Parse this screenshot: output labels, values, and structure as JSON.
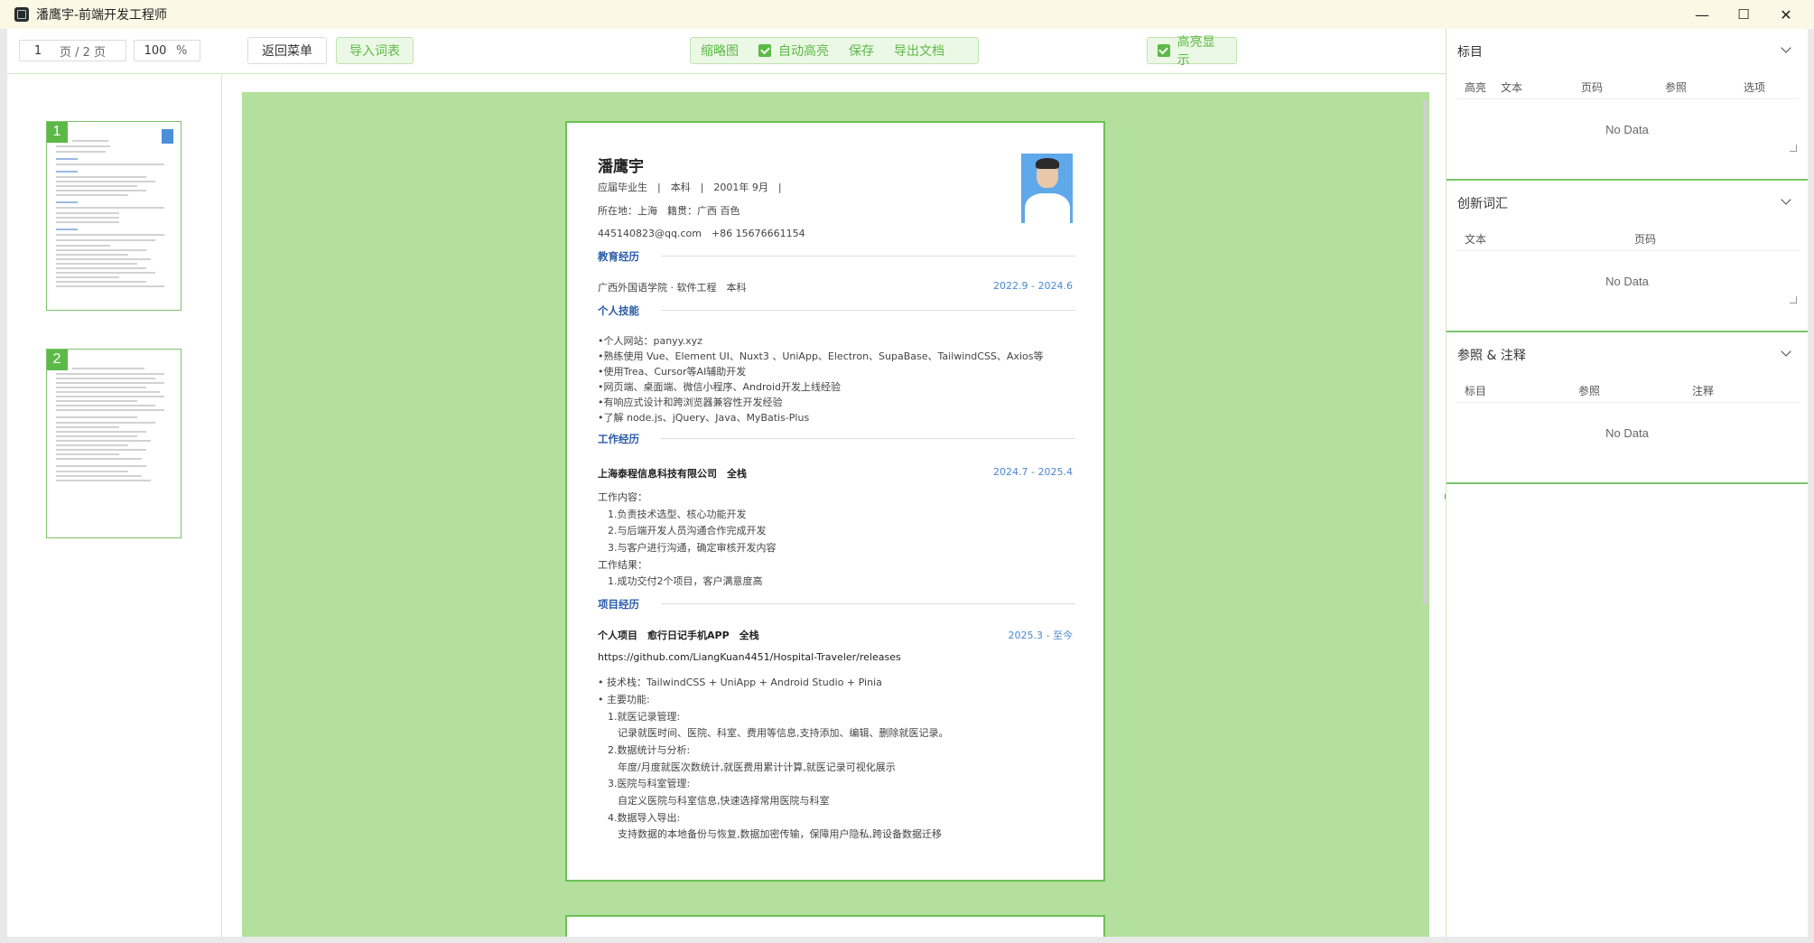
{
  "window": {
    "title": "潘鹰宇-前端开发工程师",
    "controls": [
      "—",
      "☐",
      "✕"
    ]
  },
  "pager": {
    "page": "1",
    "page_total": "页 / 2 页",
    "zoom": "100",
    "zoom_unit": "%"
  },
  "thumbnails": [
    {
      "number": "1"
    },
    {
      "number": "2"
    }
  ],
  "toolbar": {
    "back_menu": "返回菜单",
    "import_vocab": "导入词表",
    "thumbnail": "缩略图",
    "auto_highlight": "自动高亮",
    "save": "保存",
    "export_doc": "导出文档",
    "highlight_display": "高亮显示"
  },
  "resume": {
    "name": "潘鹰宇",
    "info1": "应届毕业生　|　本科　|　2001年 9月　|",
    "info2": "所在地：上海　籍贯：广西 百色",
    "info3": "445140823@qq.com　+86 15676661154",
    "education": {
      "title": "教育经历",
      "school": "广西外国语学院 · 软件工程　本科",
      "date": "2022.9 - 2024.6"
    },
    "skills": {
      "title": "个人技能",
      "items": [
        "•个人网站：panyy.xyz",
        "•熟练使用 Vue、Element UI、Nuxt3 、UniApp、Electron、SupaBase、TailwindCSS、Axios等",
        "•使用Trea、Cursor等AI辅助开发",
        "•网页端、桌面端、微信小程序、Android开发上线经验",
        "•有响应式设计和跨浏览器兼容性开发经验",
        "•了解 node.js、jQuery、Java、MyBatis-Plus"
      ]
    },
    "work": {
      "title": "工作经历",
      "company": "上海泰程信息科技有限公司　全栈",
      "date": "2024.7 - 2025.4",
      "lines": [
        "工作内容：",
        "　1.负责技术选型、核心功能开发",
        "　2.与后端开发人员沟通合作完成开发",
        "　3.与客户进行沟通，确定审核开发内容",
        "工作结果：",
        "　1.成功交付2个项目，客户满意度高"
      ]
    },
    "project": {
      "title": "项目经历",
      "name": "个人项目　愈行日记手机APP　全栈",
      "date": "2025.3 - 至今",
      "url": "https://github.com/LiangKuan4451/Hospital-Traveler/releases",
      "lines": [
        "• 技术栈：TailwindCSS + UniApp + Android Studio + Pinia",
        "• 主要功能:",
        "　1.就医记录管理:",
        "　　记录就医时间、医院、科室、费用等信息,支持添加、编辑、删除就医记录。",
        "　2.数据统计与分析:",
        "　　年度/月度就医次数统计,就医费用累计计算,就医记录可视化展示",
        "　3.医院与科室管理:",
        "　　自定义医院与科室信息,快速选择常用医院与科室",
        "　4.数据导入导出:",
        "　　支持数据的本地备份与恢复,数据加密传输，保障用户隐私,跨设备数据迁移"
      ]
    }
  },
  "right": {
    "sections": [
      {
        "title": "标目",
        "columns": [
          "高亮",
          "文本",
          "页码",
          "参照",
          "选项"
        ],
        "empty": "No Data"
      },
      {
        "title": "创新词汇",
        "columns": [
          "文本",
          "页码"
        ],
        "empty": "No Data"
      },
      {
        "title": "参照 & 注释",
        "columns": [
          "标目",
          "参照",
          "注释"
        ],
        "empty": "No Data"
      }
    ]
  },
  "colors": {
    "accent": "#5cb947",
    "viewer_bg": "#b3e09c",
    "link": "#4a88d0",
    "section": "#2a5ba8"
  }
}
